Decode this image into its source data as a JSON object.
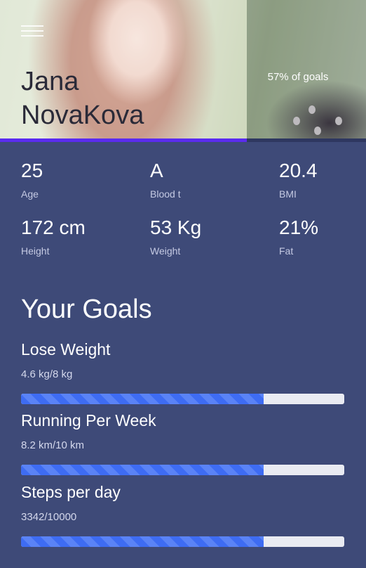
{
  "profile": {
    "first_name": "Jana",
    "last_name": "NovaKova",
    "goals_summary": "57% of goals",
    "goals_fraction": 0.57
  },
  "stats": [
    {
      "value": "25",
      "label": "Age"
    },
    {
      "value": "A",
      "label": "Blood t"
    },
    {
      "value": "20.4",
      "label": "BMI"
    },
    {
      "value": "172 cm",
      "label": "Height"
    },
    {
      "value": "53 Kg",
      "label": "Weight"
    },
    {
      "value": "21%",
      "label": "Fat"
    }
  ],
  "goals_section": {
    "title": "Your Goals",
    "items": [
      {
        "title": "Lose Weight",
        "progress": "4.6 kg/8 kg",
        "fraction": 0.75
      },
      {
        "title": "Running Per Week",
        "progress": "8.2 km/10 km",
        "fraction": 0.75
      },
      {
        "title": "Steps per day",
        "progress": "3342/10000",
        "fraction": 0.75
      }
    ]
  },
  "icons": {
    "menu": "hamburger-menu-icon"
  },
  "colors": {
    "background": "#3e4a78",
    "accent_bar": "#5a2bf0",
    "progress_fill": "#3e6cf3",
    "progress_track": "#e9ebf2"
  }
}
